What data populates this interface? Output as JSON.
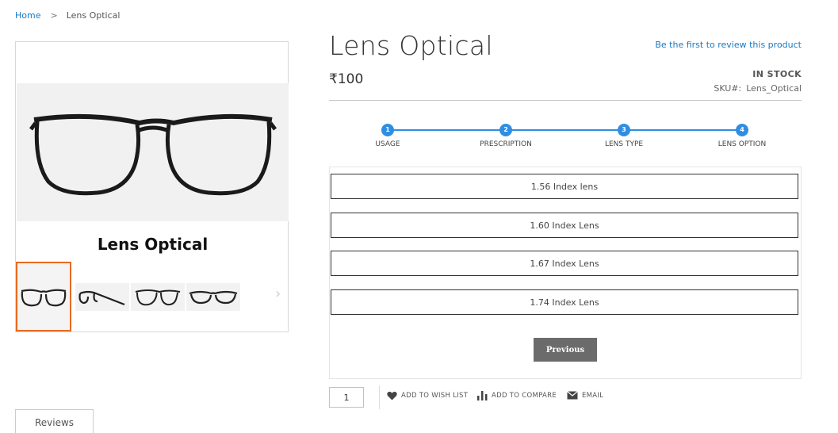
{
  "breadcrumb": {
    "home": "Home",
    "separator": ">",
    "current": "Lens Optical"
  },
  "gallery": {
    "caption": "Lens Optical",
    "thumbnails": [
      "front-view",
      "side-view",
      "angle-view",
      "front-flat-view"
    ],
    "next_icon": "›"
  },
  "product": {
    "name": "Lens Optical",
    "review_link": "Be the first to review this product",
    "price": "₹100",
    "stock": "IN STOCK",
    "sku_label": "SKU#:",
    "sku_value": "Lens_Optical"
  },
  "steps": [
    {
      "number": "1",
      "label": "USAGE"
    },
    {
      "number": "2",
      "label": "PRESCRIPTION"
    },
    {
      "number": "3",
      "label": "LENS TYPE"
    },
    {
      "number": "4",
      "label": "LENS OPTION"
    }
  ],
  "lens_options": [
    "1.56 Index lens",
    "1.60 Index Lens",
    "1.67 Index Lens",
    "1.74 Index Lens"
  ],
  "previous_label": "Previous",
  "quantity": "1",
  "actions": {
    "wishlist": "ADD TO WISH LIST",
    "compare": "ADD TO COMPARE",
    "email": "EMAIL"
  },
  "tabs": {
    "reviews": "Reviews"
  },
  "colors": {
    "accent": "#2f8ee3",
    "link": "#1979c3",
    "thumb_active": "#e66a21",
    "button": "#6b6b6b"
  }
}
